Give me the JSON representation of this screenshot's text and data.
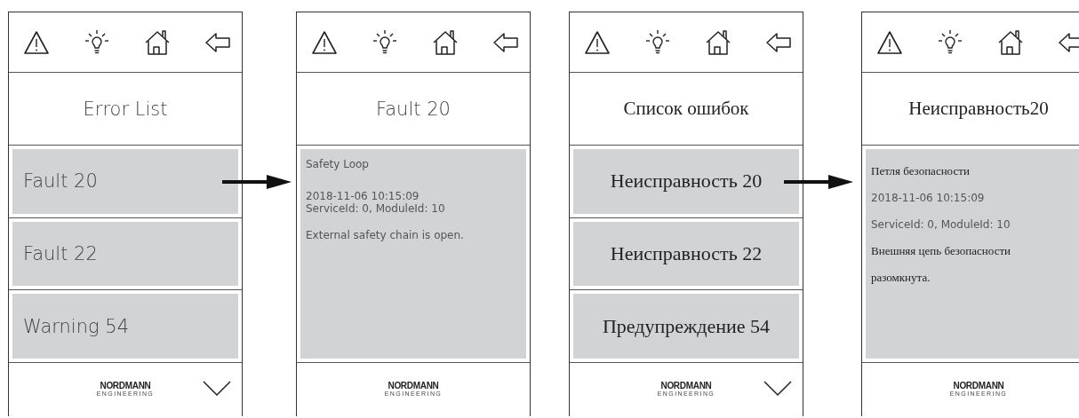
{
  "screens": [
    {
      "kind": "list",
      "title": "Error List",
      "items": [
        {
          "text": "Fault 20"
        },
        {
          "text": "Fault 22"
        },
        {
          "text": "Warning 54"
        }
      ],
      "logo": {
        "wordmark": "NORDMANN",
        "tagline": "ENGINEERING"
      },
      "more_below": true
    },
    {
      "kind": "detail",
      "title": "Fault 20",
      "lines": [
        {
          "kind": "name",
          "text": "Safety Loop"
        },
        {
          "kind": "meta",
          "text": "2018-11-06 10:15:09"
        },
        {
          "kind": "meta",
          "text": "ServiceId: 0, ModuleId: 10"
        },
        {
          "kind": "message",
          "text": "External safety chain is open."
        }
      ],
      "logo": {
        "wordmark": "NORDMANN",
        "tagline": "ENGINEERING"
      },
      "more_below": false
    },
    {
      "kind": "list",
      "title": "Список ошибок",
      "items": [
        {
          "text": "Неисправность 20"
        },
        {
          "text": "Неисправность 22"
        },
        {
          "text": "Предупреждение 54"
        }
      ],
      "logo": {
        "wordmark": "NORDMANN",
        "tagline": "ENGINEERING"
      },
      "more_below": true
    },
    {
      "kind": "detail",
      "title": "Неисправность20",
      "lines": [
        {
          "kind": "name",
          "text": "Петля безопасности"
        },
        {
          "kind": "meta",
          "text": "2018-11-06 10:15:09"
        },
        {
          "kind": "meta",
          "text": "ServiceId: 0, ModuleId: 10"
        },
        {
          "kind": "message",
          "text": "Внешняя цепь безопасности разомкнута."
        }
      ],
      "logo": {
        "wordmark": "NORDMANN",
        "tagline": "ENGINEERING"
      },
      "more_below": false
    }
  ]
}
